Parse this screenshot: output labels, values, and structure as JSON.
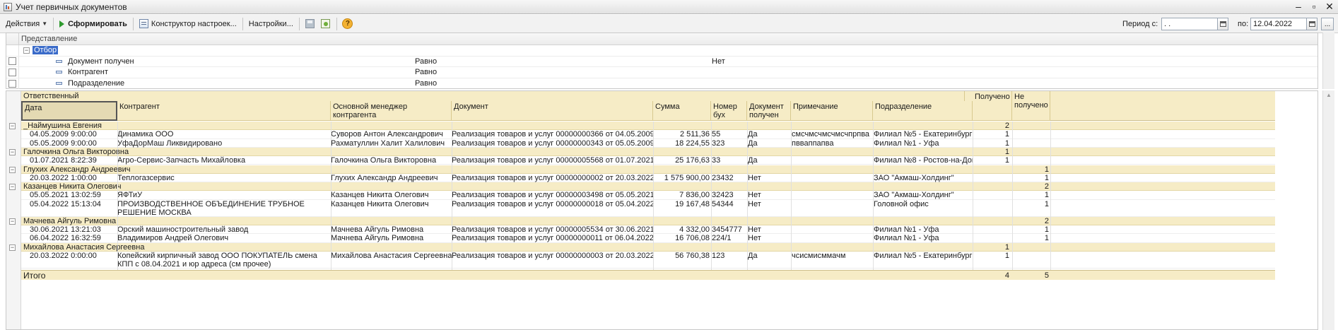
{
  "window": {
    "title": "Учет первичных документов",
    "controls": [
      "–",
      "▫",
      "✕"
    ]
  },
  "toolbar": {
    "actions_label": "Действия",
    "generate_label": "Сформировать",
    "constructor_label": "Конструктор настроек...",
    "settings_label": "Настройки...",
    "help_glyph": "?"
  },
  "period": {
    "from_label": "Период с:",
    "from_value": " .  .",
    "to_label": "по:",
    "to_value": "12.04.2022",
    "more_label": "..."
  },
  "filters": {
    "header": "Представление",
    "group_label": "Отбор",
    "items": [
      {
        "name": "Документ получен",
        "condition": "Равно",
        "value": "Нет"
      },
      {
        "name": "Контрагент",
        "condition": "Равно",
        "value": ""
      },
      {
        "name": "Подразделение",
        "condition": "Равно",
        "value": ""
      }
    ]
  },
  "report": {
    "header": {
      "responsible": "Ответственный",
      "date": "Дата",
      "counterparty": "Контрагент",
      "manager": "Основной менеджер контрагента",
      "document": "Документ",
      "sum": "Сумма",
      "number": "Номер бух",
      "received_doc": "Документ получен",
      "note": "Примечание",
      "division": "Подразделение",
      "received": "Получено",
      "not_received": "Не получено"
    },
    "groups": [
      {
        "name": "_Наймушина Евгения",
        "received": "2",
        "not_received": "",
        "rows": [
          {
            "date": "04.05.2009 9:00:00",
            "counterparty": "Динамика ООО",
            "manager": "Суворов Антон Александрович",
            "document": "Реализация товаров и услуг 00000000366 от 04.05.2009 9:00:00",
            "sum": "2 511,36",
            "number": "55",
            "received_doc": "Да",
            "note": "смсчмсчмсчмсчпрпва",
            "division": "Филиал №5 - Екатеринбург",
            "received": "1",
            "not_received": ""
          },
          {
            "date": "05.05.2009 9:00:00",
            "counterparty": "УфаДорМаш Ликвидировано",
            "manager": "Рахматуллин Халит Халилович",
            "document": "Реализация товаров и услуг 00000000343 от 05.05.2009 9:00:00",
            "sum": "18 224,55",
            "number": "323",
            "received_doc": "Да",
            "note": "пвваппапва",
            "division": "Филиал №1 - Уфа",
            "received": "1",
            "not_received": ""
          }
        ]
      },
      {
        "name": "Галочкина Ольга Викторовна",
        "received": "1",
        "not_received": "",
        "rows": [
          {
            "date": "01.07.2021 8:22:39",
            "counterparty": "Агро-Сервис-Запчасть Михайловка",
            "manager": "Галочкина Ольга Викторовна",
            "document": "Реализация товаров и услуг 00000005568 от 01.07.2021 8:22:39",
            "sum": "25 176,63",
            "number": "33",
            "received_doc": "Да",
            "note": "",
            "division": "Филиал №8 - Ростов-на-Дону",
            "received": "1",
            "not_received": ""
          }
        ]
      },
      {
        "name": "Глухих Александр Андреевич",
        "received": "",
        "not_received": "1",
        "rows": [
          {
            "date": "20.03.2022 1:00:00",
            "counterparty": "Теплогазсервис",
            "manager": "Глухих Александр Андреевич",
            "document": "Реализация товаров и услуг 00000000002 от 20.03.2022 1:00:00",
            "sum": "1 575 900,00",
            "number": "23432",
            "received_doc": "Нет",
            "note": "",
            "division": "ЗАО \"Акмаш-Холдинг\"",
            "received": "",
            "not_received": "1"
          }
        ]
      },
      {
        "name": "Казанцев Никита Олегович",
        "received": "",
        "not_received": "2",
        "rows": [
          {
            "date": "05.05.2021 13:02:59",
            "counterparty": "ЯФТиУ",
            "manager": "Казанцев Никита Олегович",
            "document": "Реализация товаров и услуг 00000003498 от 05.05.2021 13:02:59",
            "sum": "7 836,00",
            "number": "32423",
            "received_doc": "Нет",
            "note": "",
            "division": "ЗАО \"Акмаш-Холдинг\"",
            "received": "",
            "not_received": "1"
          },
          {
            "date": "05.04.2022 15:13:04",
            "counterparty": "ПРОИЗВОДСТВЕННОЕ ОБЪЕДИНЕНИЕ ТРУБНОЕ  РЕШЕНИЕ МОСКВА",
            "manager": "Казанцев Никита Олегович",
            "document": "Реализация товаров и услуг 00000000018 от 05.04.2022 15:13:04",
            "sum": "19 167,48",
            "number": "54344",
            "received_doc": "Нет",
            "note": "",
            "division": "Головной офис",
            "received": "",
            "not_received": "1"
          }
        ]
      },
      {
        "name": "Мачнева Айгуль Римовна",
        "received": "",
        "not_received": "2",
        "rows": [
          {
            "date": "30.06.2021 13:21:03",
            "counterparty": "Орский машиностроительный завод",
            "manager": "Мачнева Айгуль Римовна",
            "document": "Реализация товаров и услуг 00000005534 от 30.06.2021 13:21:03",
            "sum": "4 332,00",
            "number": "3454777",
            "received_doc": "Нет",
            "note": "",
            "division": "Филиал №1 - Уфа",
            "received": "",
            "not_received": "1"
          },
          {
            "date": "06.04.2022 16:32:59",
            "counterparty": "Владимиров Андрей Олегович",
            "manager": "Мачнева Айгуль Римовна",
            "document": "Реализация товаров и услуг 00000000011 от 06.04.2022 16:32:59",
            "sum": "16 706,08",
            "number": "224/1",
            "received_doc": "Нет",
            "note": "",
            "division": "Филиал №1 - Уфа",
            "received": "",
            "not_received": "1"
          }
        ]
      },
      {
        "name": "Михайлова Анастасия Сергеевна",
        "received": "1",
        "not_received": "",
        "rows": [
          {
            "date": "20.03.2022 0:00:00",
            "counterparty": "Копейский кирпичный завод ООО ПОКУПАТЕЛЬ смена КПП с 08.04.2021 и юр адреса (см прочее)",
            "manager": "Михайлова Анастасия Сергеевна",
            "document": "Реализация товаров и услуг 00000000003 от 20.03.2022 0:00:00",
            "sum": "56 760,38",
            "number": "123",
            "received_doc": "Да",
            "note": "чсисмисммачм",
            "division": "Филиал №5 - Екатеринбург",
            "received": "1",
            "not_received": ""
          }
        ]
      }
    ],
    "total": {
      "label": "Итого",
      "received": "4",
      "not_received": "5"
    }
  }
}
